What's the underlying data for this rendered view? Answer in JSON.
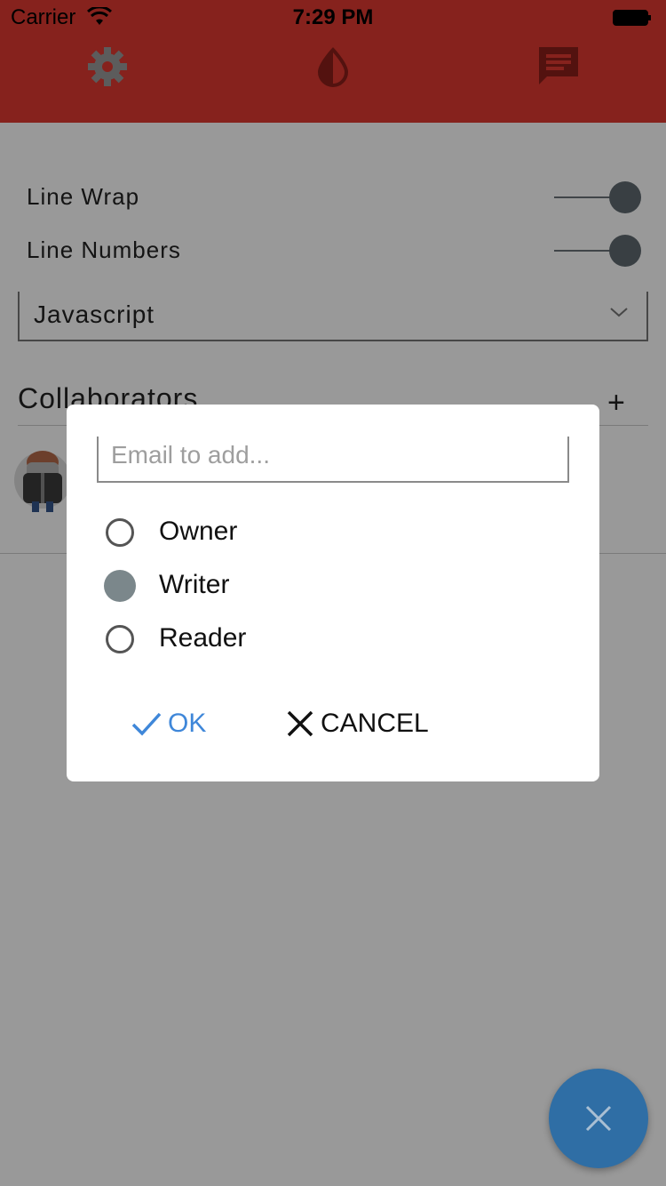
{
  "status_bar": {
    "carrier": "Carrier",
    "time": "7:29 PM"
  },
  "toolbar": {
    "tabs": [
      {
        "icon": "gear-icon"
      },
      {
        "icon": "contrast-icon"
      },
      {
        "icon": "chat-icon"
      }
    ]
  },
  "settings": {
    "line_wrap": {
      "label": "Line Wrap",
      "enabled": true
    },
    "line_numbers": {
      "label": "Line Numbers",
      "enabled": true
    },
    "language": {
      "selected": "Javascript"
    }
  },
  "collaborators": {
    "title": "Collaborators",
    "add_label": "+"
  },
  "dialog": {
    "email_placeholder": "Email to add...",
    "email_value": "",
    "roles": [
      {
        "label": "Owner",
        "selected": false
      },
      {
        "label": "Writer",
        "selected": true
      },
      {
        "label": "Reader",
        "selected": false
      }
    ],
    "ok_label": "OK",
    "cancel_label": "CANCEL"
  },
  "colors": {
    "toolbar": "#e03a31",
    "accent": "#3f87d9",
    "fab": "#2f6ea5"
  }
}
